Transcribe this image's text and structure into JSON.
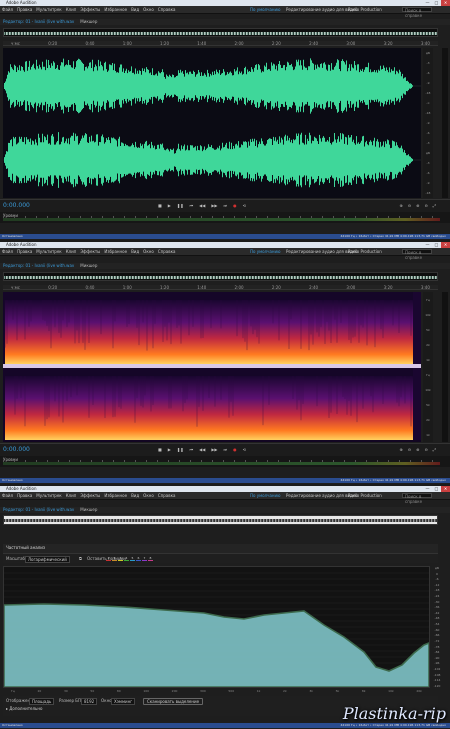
{
  "app": {
    "title": "Adobe Audition",
    "controls": [
      "—",
      "□",
      "✕"
    ]
  },
  "menu": [
    "Файл",
    "Правка",
    "Мультитрек",
    "Клип",
    "Эффекты",
    "Избранное",
    "Вид",
    "Окно",
    "Справка"
  ],
  "workspace": {
    "default_label": "По умолчанию",
    "edit_cd": "Редактирование аудио для видео",
    "radio": "Radio Production",
    "search_placeholder": "Поиск в справке"
  },
  "editor_tab": "Редактор: 01 - Ivanii (live with.wav",
  "mixer_tab": "Микшер",
  "ruler_ticks": [
    "ч:мс",
    "0:20",
    "0:40",
    "1:00",
    "1:20",
    "1:40",
    "2:00",
    "2:20",
    "2:40",
    "3:00",
    "3:20",
    "3:40"
  ],
  "db_scale": [
    "дБ",
    "-3",
    "-6",
    "-9",
    "-18",
    "-∞",
    "-18",
    "-9",
    "-6",
    "-3",
    "дБ",
    "-3",
    "-6",
    "-9",
    "-18"
  ],
  "hz_scale": [
    "Гц",
    "10k",
    "5k",
    "2k",
    "1k",
    "Гц",
    "10k",
    "5k",
    "2k",
    "1k"
  ],
  "timecode": "0:00.000",
  "levels_label": "Уровни",
  "status": {
    "left": "Остановлено",
    "right": "44100 Гц • 16-бит • Стерео     41,91 MB     4:09.196     113,71 GB свободно"
  },
  "freq": {
    "panel_title": "Частотный анализ",
    "scale_label": "Масштаб:",
    "scale_value": "Логарифмический",
    "collect_label": "Оставить позиции",
    "hold_slots": [
      "1",
      "2",
      "3",
      "4",
      "5",
      "6",
      "7",
      "8"
    ],
    "hold_colors": [
      "#c83232",
      "#c88a2a",
      "#c8c82a",
      "#3aa83a",
      "#2a9ac8",
      "#3a5ac8",
      "#8a3ac8",
      "#c83a8a"
    ],
    "db_axis": [
      "дБ",
      "0",
      "-6",
      "-12",
      "-18",
      "-24",
      "-30",
      "-36",
      "-42",
      "-48",
      "-54",
      "-60",
      "-66",
      "-72",
      "-78",
      "-84",
      "-90",
      "-96",
      "-102",
      "-108",
      "-114",
      "-120"
    ],
    "hz_axis": [
      "Гц",
      "20",
      "30",
      "50",
      "80",
      "100",
      "200",
      "300",
      "500",
      "1k",
      "2k",
      "3k",
      "5k",
      "8k",
      "10k",
      "20k"
    ],
    "footer": {
      "display_label": "Отображение:",
      "display_value": "Площадь",
      "fft_label": "Размер БПФ:",
      "fft_value": "8192",
      "window_label": "Окно:",
      "window_value": "Хэмминг",
      "scan_button": "Сканировать выделение",
      "advanced": "Дополнительно"
    }
  },
  "watermark": "Plastinka-rip"
}
